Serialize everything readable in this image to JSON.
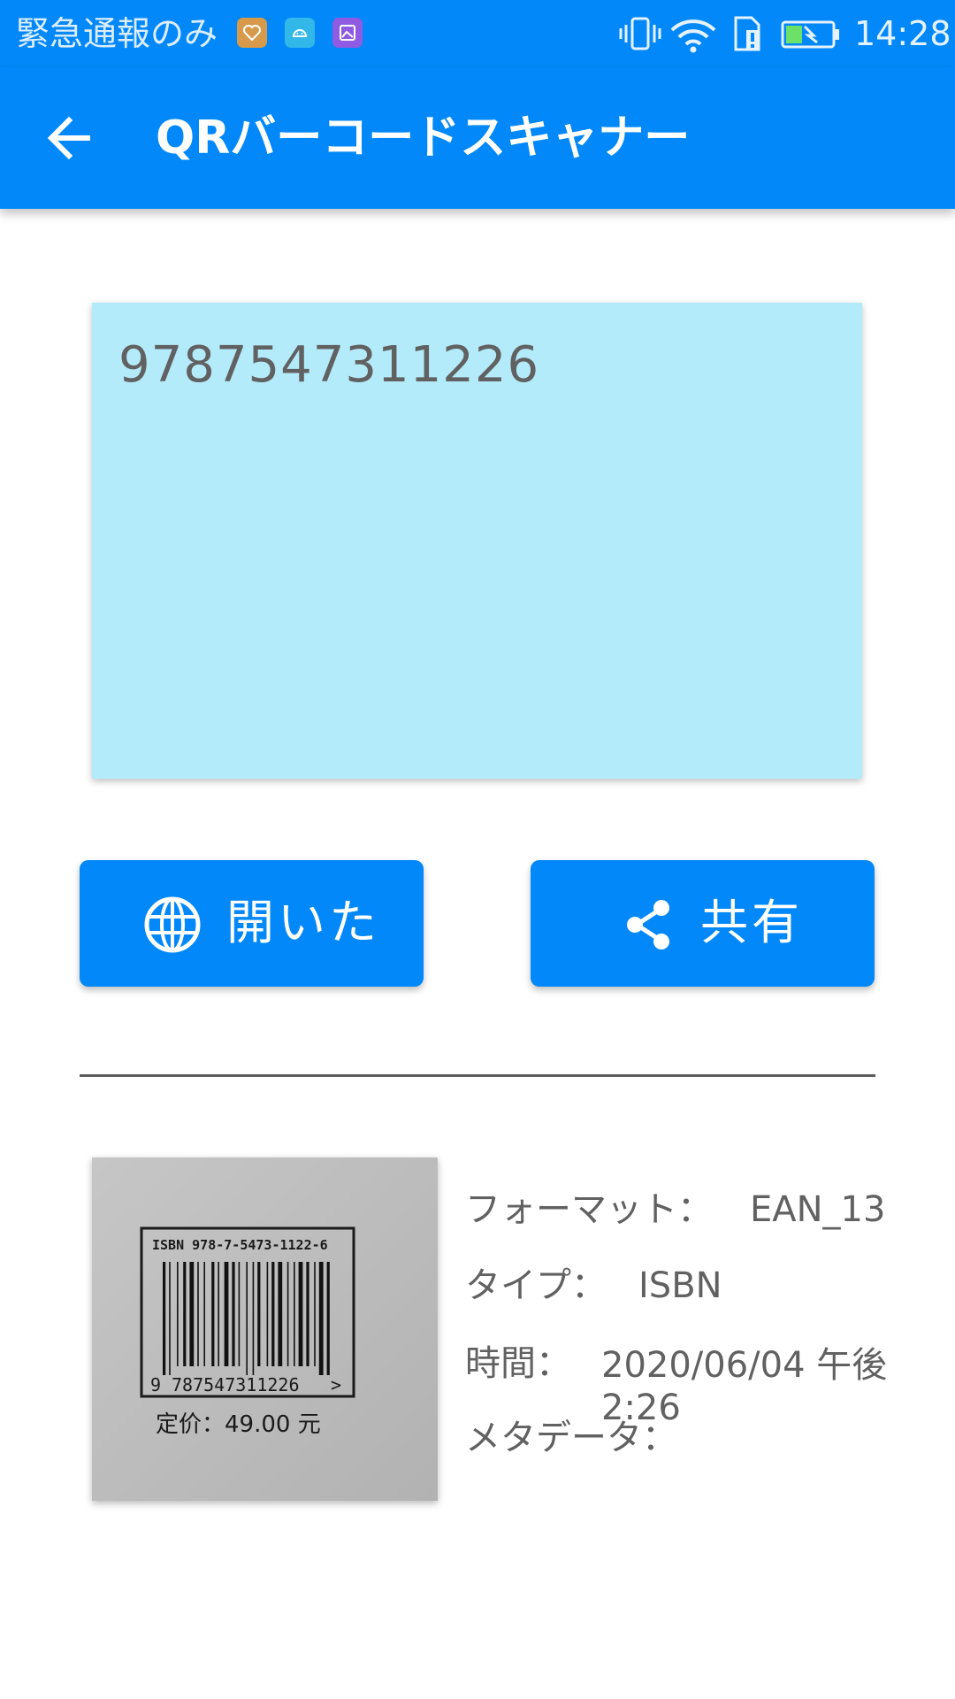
{
  "status_bar": {
    "carrier_text": "緊急通報のみ",
    "time": "14:28"
  },
  "app_bar": {
    "title": "QRバーコードスキャナー",
    "back_icon": "arrow-back-icon"
  },
  "result": {
    "content": "9787547311226"
  },
  "actions": {
    "open_label": "開いた",
    "open_icon": "globe-icon",
    "share_label": "共有",
    "share_icon": "share-icon"
  },
  "image": {
    "isbn_header": "ISBN 978-7-5473-1122-6",
    "digits_prefix": "9",
    "digits_main": "787547311226",
    "digits_suffix": ">",
    "price": "定价：49.00 元"
  },
  "details": {
    "format_label": "フォーマット：",
    "format_value": "EAN_13",
    "type_label": "タイプ：",
    "type_value": "ISBN",
    "time_label": "時間：",
    "time_value_line1": "2020/06/04 午後",
    "time_value_line2": "2:26",
    "metadata_label": "メタデータ："
  },
  "colors": {
    "primary": "#0288f8",
    "result_background": "#b3ebfb",
    "text": "#616161"
  }
}
